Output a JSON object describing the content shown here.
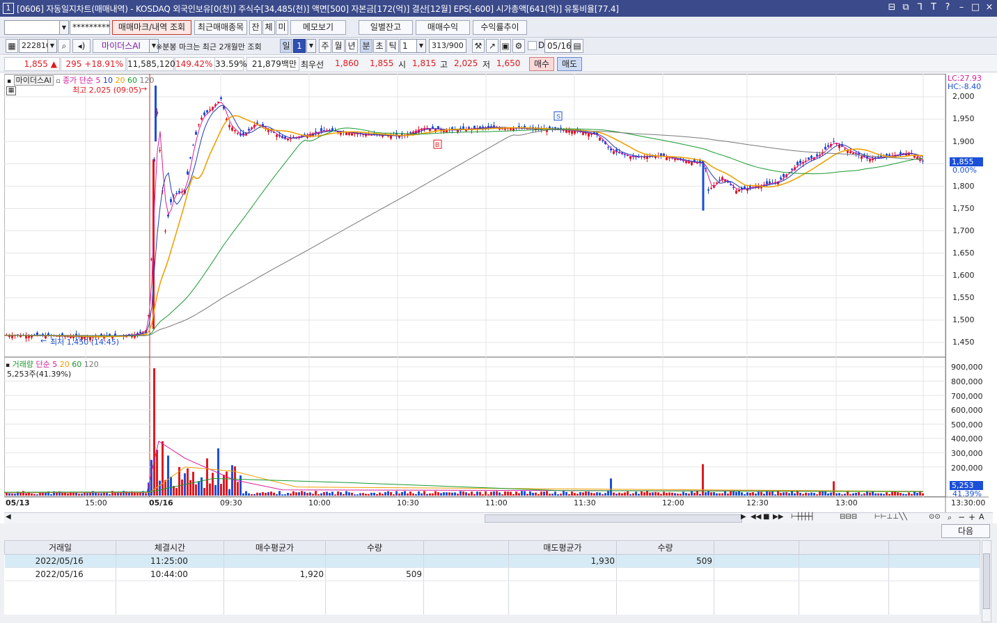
{
  "window": {
    "number": "1",
    "title": "[0606] 자동일지차트(매매내역) - KOSDAQ 외국인보유[0(천)] 주식수[34,485(천)] 액면[500] 자본금[172(억)] 결산[12월] EPS[-600] 시가총액[641(억)] 유통비율[77.4]",
    "controls": [
      "⊟",
      "⧉",
      "ᒣ",
      "T",
      "?",
      "–",
      "□",
      "×"
    ]
  },
  "toolbar1": {
    "account_value": "",
    "password_mask": "*********",
    "buttons": [
      "매매마크/내역 조회",
      "최근매매종목",
      "잔",
      "체",
      "미",
      "메모보기"
    ],
    "right_buttons": [
      "일별잔고",
      "매매수익",
      "수익률추이"
    ]
  },
  "toolbar2": {
    "code": "222810",
    "indicator": "마이더스AI",
    "note": "※분봉 마크는 최근 2개월만 조회",
    "periods": [
      "일",
      "1",
      "주",
      "월",
      "년",
      "분",
      "초",
      "틱"
    ],
    "period_value": "1",
    "count": "313",
    "count_total": "/900",
    "date_check": "D",
    "date": "05/16"
  },
  "quote": {
    "price": "1,855",
    "change": "295",
    "change_pct": "+18.91%",
    "volume": "11,585,120",
    "vol_ratio": "149.42%",
    "turnover": "33.59%",
    "amount": "21,879백만",
    "best_label": "최우선",
    "best_ask": "1,860",
    "best_bid": "1,855",
    "open_label": "시",
    "open": "1,815",
    "high_label": "고",
    "high": "2,025",
    "low_label": "저",
    "low": "1,650",
    "buy_btn": "매수",
    "sell_btn": "매도"
  },
  "price_panel": {
    "legend_tag": "마이더스AI",
    "legend_label": "종가 단순",
    "ma_periods": [
      "5",
      "10",
      "20",
      "60",
      "120"
    ],
    "ma_colors": [
      "#d81b9a",
      "#1f3bb3",
      "#f0a000",
      "#169a2f",
      "#777777"
    ],
    "high_note": "최고 2,025 (09:05)",
    "low_note": "최저 1,450 (14:45)",
    "lc": "LC:27.93",
    "hc": "HC:-8.40",
    "cur_price": "1,855",
    "cur_pct": "0.00%",
    "y_ticks": [
      "2,000",
      "1,950",
      "1,900",
      "1,850",
      "1,800",
      "1,750",
      "1,700",
      "1,650",
      "1,600",
      "1,550",
      "1,500",
      "1,450"
    ],
    "mark_buy": "B",
    "mark_sell": "S"
  },
  "volume_panel": {
    "legend_label": "거래량",
    "legend_sub": "단순",
    "ma_periods": [
      "5",
      "20",
      "60",
      "120"
    ],
    "info": "5,253주(41.39%)",
    "cur_vol": "5,253",
    "cur_pct": "41.39%",
    "y_ticks": [
      "900,000",
      "800,000",
      "700,000",
      "600,000",
      "500,000",
      "400,000",
      "300,000",
      "200,000"
    ]
  },
  "x_axis": {
    "labels": [
      "05/13",
      "15:00",
      "05/16",
      "09:30",
      "10:00",
      "10:30",
      "11:00",
      "11:30",
      "12:00",
      "12:30",
      "13:00"
    ],
    "end_label": "13:30:00"
  },
  "colors": {
    "up": "#e0191f",
    "down": "#1a4fd8",
    "title_bg": "#3a4a8a"
  },
  "trades": {
    "next_button": "다음",
    "headers": [
      "거래일",
      "체결시간",
      "매수평균가",
      "수량",
      "",
      "매도평균가",
      "수량",
      "",
      "",
      ""
    ],
    "rows": [
      [
        "2022/05/16",
        "11:25:00",
        "",
        "",
        "",
        "1,930",
        "509",
        "",
        "",
        ""
      ],
      [
        "2022/05/16",
        "10:44:00",
        "1,920",
        "509",
        "",
        "",
        "",
        "",
        "",
        ""
      ]
    ]
  }
}
